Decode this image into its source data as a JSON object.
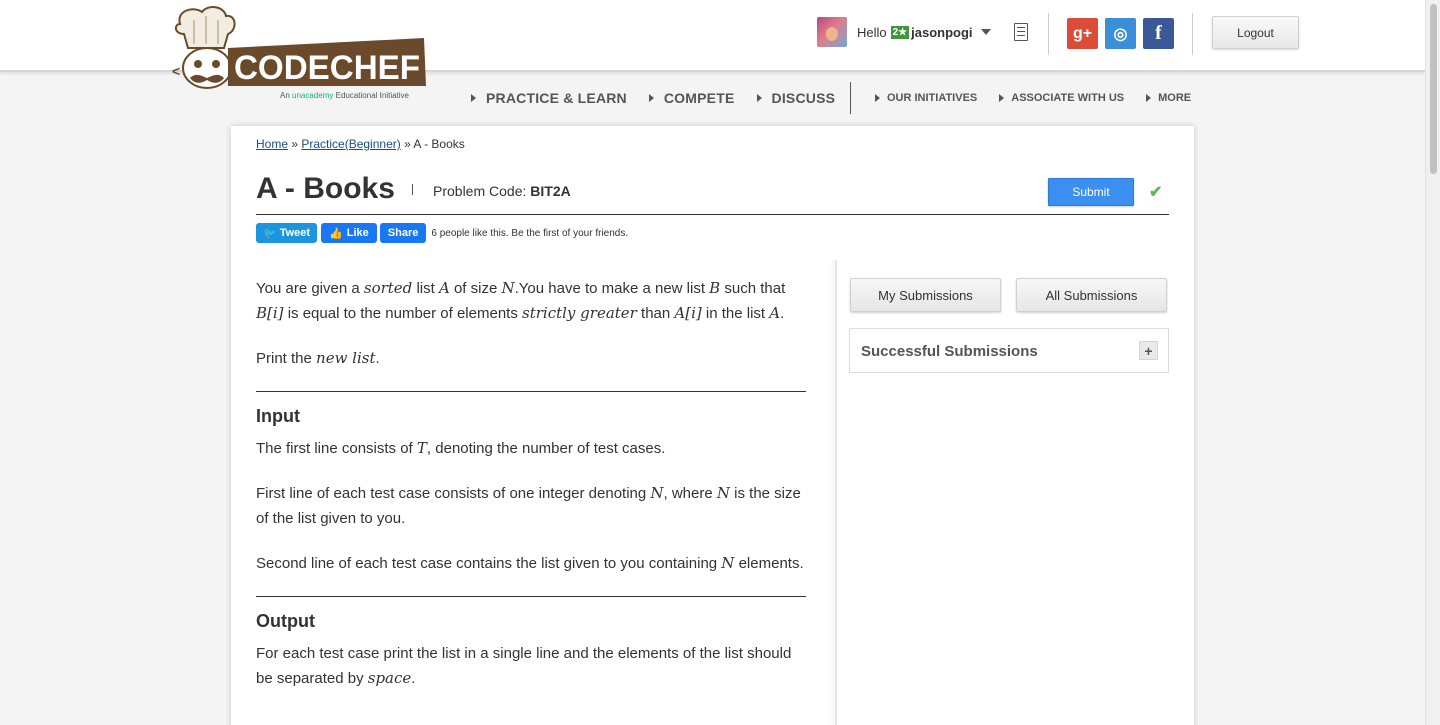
{
  "header": {
    "logo_text": "CODECHEF",
    "logo_tagline_prefix": "An",
    "logo_tagline_brand": "unacademy",
    "logo_tagline_suffix": "Educational Initiative",
    "greeting": "Hello",
    "star_badge": "2★",
    "username": "jasonpogi",
    "logout_label": "Logout",
    "social": {
      "google": "g+",
      "github": "◎",
      "facebook": "f"
    }
  },
  "nav": {
    "main": [
      "PRACTICE & LEARN",
      "COMPETE",
      "DISCUSS"
    ],
    "secondary": [
      "OUR INITIATIVES",
      "ASSOCIATE WITH US",
      "MORE"
    ]
  },
  "breadcrumb": {
    "home": "Home",
    "sep1": " » ",
    "practice": "Practice(Beginner)",
    "sep2": " » ",
    "current": "A - Books"
  },
  "problem": {
    "title": "A - Books",
    "code_label": "Problem Code:",
    "code": "BIT2A",
    "submit_label": "Submit",
    "check": "✔"
  },
  "social_bar": {
    "tweet": "Tweet",
    "like": "Like",
    "share": "Share",
    "likes_text": "6 people like this. Be the first of your friends."
  },
  "statement": {
    "p1": [
      "You are given a ",
      "sorted",
      " list ",
      "A",
      " of size ",
      "N",
      ".You have to make a new list ",
      "B",
      " such that ",
      "B[i]",
      " is equal to the number of elements ",
      "strictly greater",
      " than ",
      "A[i]",
      " in the list ",
      "A",
      "."
    ],
    "p2": [
      "Print the ",
      "new list",
      "."
    ],
    "input_heading": "Input",
    "input_p1": [
      "The first line consists of ",
      "T",
      ", denoting the number of test cases."
    ],
    "input_p2": [
      "First line of each test case consists of one integer denoting ",
      "N",
      ", where ",
      "N",
      " is the size of the list given to you."
    ],
    "input_p3": [
      "Second line of each test case contains the list given to you containing ",
      "N",
      " elements."
    ],
    "output_heading": "Output",
    "output_p1": [
      "For each test case print the list in a single line and the elements of the list should be separated by ",
      "space",
      "."
    ]
  },
  "sidebar": {
    "my_submissions": "My Submissions",
    "all_submissions": "All Submissions",
    "successful_submissions": "Successful Submissions",
    "expand": "+"
  }
}
